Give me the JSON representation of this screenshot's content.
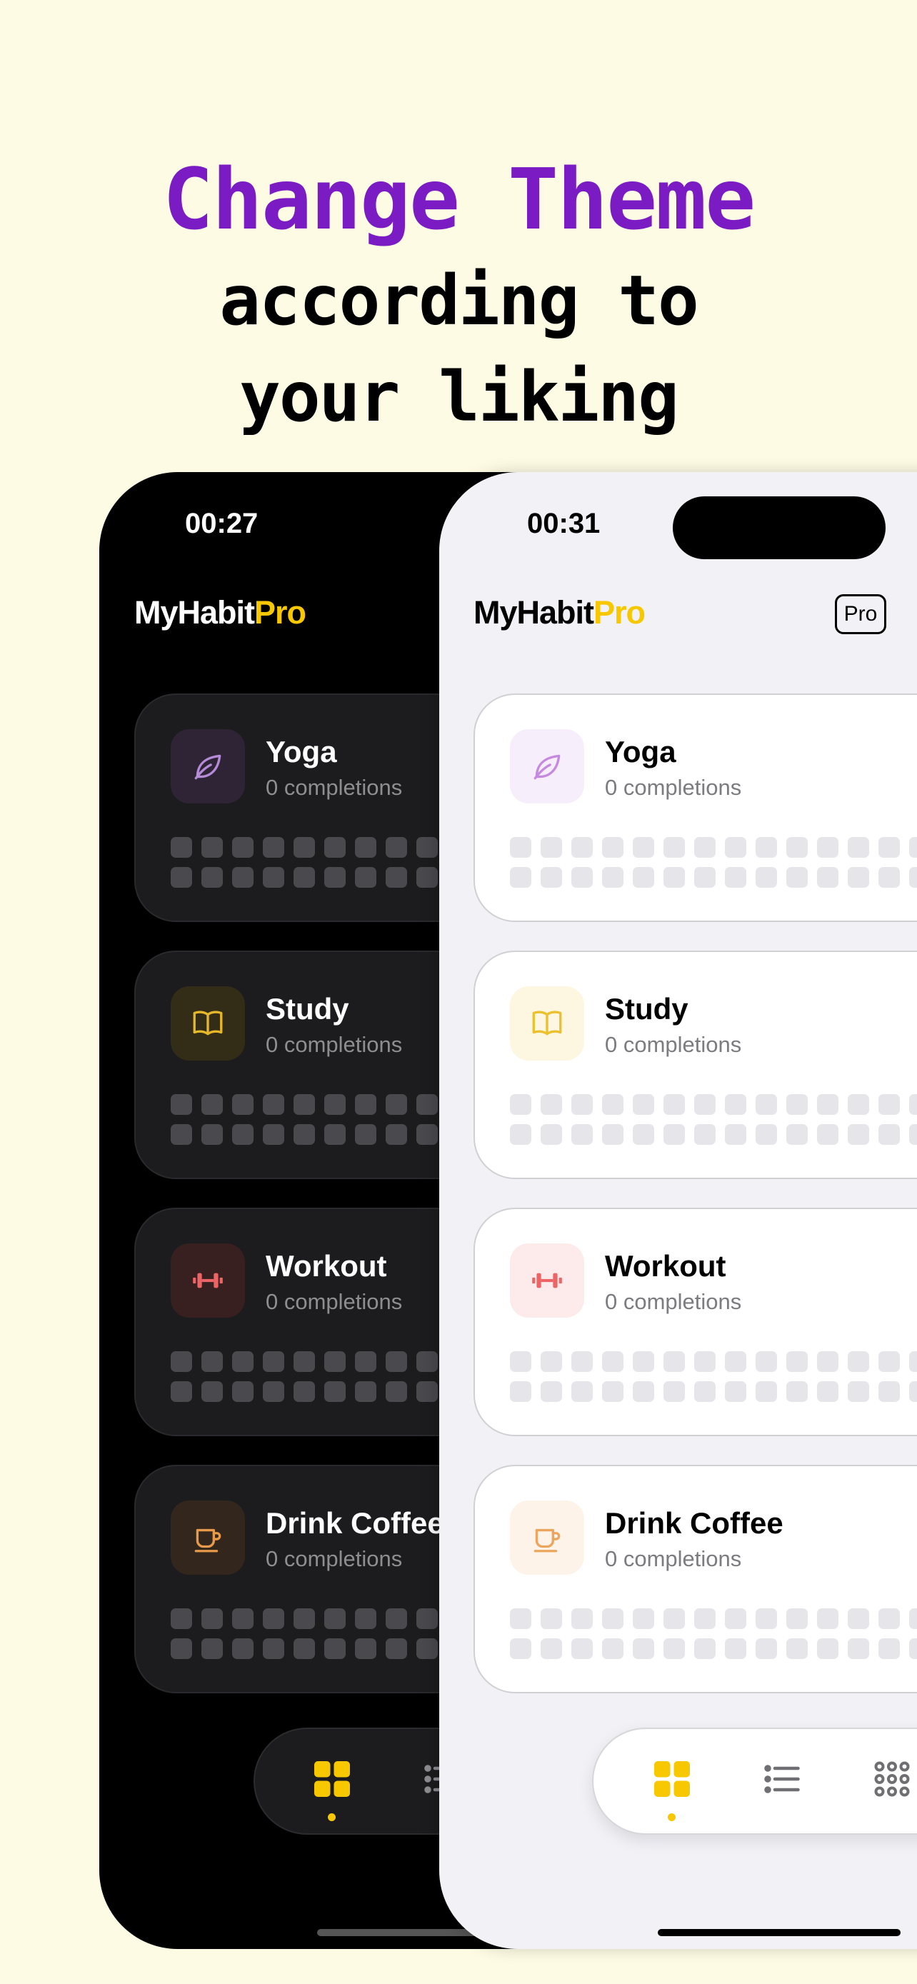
{
  "headline": {
    "line1": "Change Theme",
    "line2": "according to",
    "line3": "your liking"
  },
  "colors": {
    "background": "#fdfbe3",
    "headline_accent": "#7a1bc3",
    "brand_accent": "#f7c800",
    "dark_card": "#1c1c1e",
    "light_card": "#ffffff"
  },
  "dark_phone": {
    "time": "00:27",
    "brand": {
      "main": "MyHabit",
      "accent": "Pro"
    },
    "habits": [
      {
        "title": "Yoga",
        "subtitle": "0 completions",
        "icon": "leaf-icon"
      },
      {
        "title": "Study",
        "subtitle": "0 completions",
        "icon": "book-icon"
      },
      {
        "title": "Workout",
        "subtitle": "0 completions",
        "icon": "dumbbell-icon"
      },
      {
        "title": "Drink Coffee",
        "subtitle": "0 completions",
        "icon": "coffee-cup-icon"
      }
    ],
    "tabs": [
      "grid-view-icon",
      "list-view-icon"
    ],
    "active_tab": "grid-view-icon"
  },
  "light_phone": {
    "time": "00:31",
    "brand": {
      "main": "MyHabit",
      "accent": "Pro"
    },
    "pro_badge": "Pro",
    "habits": [
      {
        "title": "Yoga",
        "subtitle": "0 completions",
        "icon": "leaf-icon"
      },
      {
        "title": "Study",
        "subtitle": "0 completions",
        "icon": "book-icon"
      },
      {
        "title": "Workout",
        "subtitle": "0 completions",
        "icon": "dumbbell-icon"
      },
      {
        "title": "Drink Coffee",
        "subtitle": "0 completions",
        "icon": "coffee-cup-icon"
      }
    ],
    "tabs": [
      "grid-view-icon",
      "list-view-icon",
      "dots-grid-icon"
    ],
    "active_tab": "grid-view-icon"
  }
}
